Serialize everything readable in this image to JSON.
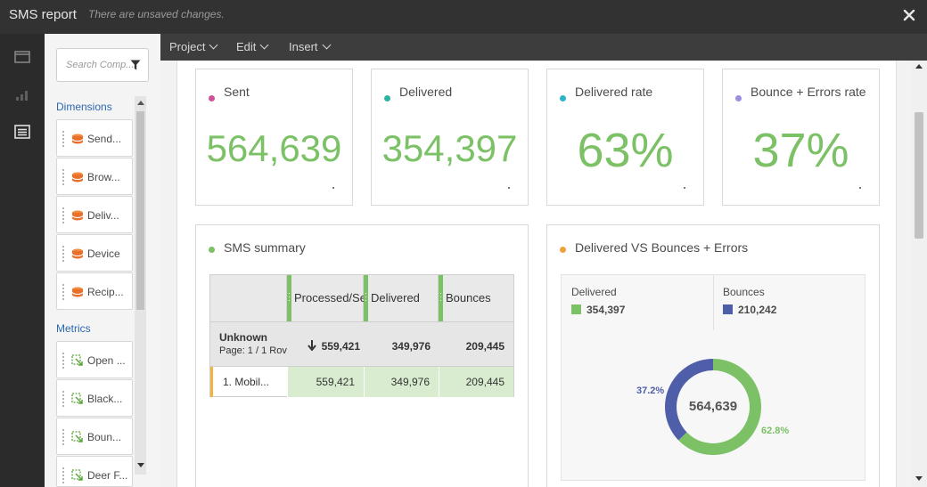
{
  "app": {
    "title": "SMS report",
    "status": "There are unsaved changes."
  },
  "rail": {
    "icons": [
      "panel-icon",
      "visualizations-icon",
      "components-icon"
    ]
  },
  "panel": {
    "search_placeholder": "Search Comp...",
    "dimensions_label": "Dimensions",
    "dimensions": [
      "Send...",
      "Brow...",
      "Deliv...",
      "Device",
      "Recip..."
    ],
    "metrics_label": "Metrics",
    "metrics": [
      "Open ...",
      "Black...",
      "Boun...",
      "Deer F..."
    ]
  },
  "menu": {
    "items": [
      "Project",
      "Edit",
      "Insert"
    ]
  },
  "kpis": [
    {
      "label": "Sent",
      "value": "564,639",
      "dot_color": "#d0519a"
    },
    {
      "label": "Delivered",
      "value": "354,397",
      "dot_color": "#2bb3a0"
    },
    {
      "label": "Delivered rate",
      "value": "63%",
      "dot_color": "#2bb3c8"
    },
    {
      "label": "Bounce + Errors rate",
      "value": "37%",
      "dot_color": "#9a8fe0"
    }
  ],
  "summary": {
    "title": "SMS summary",
    "dot_color": "#7cc166",
    "columns": [
      "Processed/Se",
      "Delivered",
      "Bounces"
    ],
    "total": {
      "name": "Unknown",
      "sub": "Page: 1 / 1  Rov",
      "values": [
        "559,421",
        "349,976",
        "209,445"
      ],
      "sort_icon": "sort-descending-icon"
    },
    "rows": [
      {
        "label": "1.    Mobil...",
        "values": [
          "559,421",
          "349,976",
          "209,445"
        ]
      }
    ]
  },
  "donut": {
    "title": "Delivered VS Bounces + Errors",
    "dot_color": "#f0a13a",
    "legend": [
      {
        "name": "Delivered",
        "value": "354,397",
        "color": "#7cc166"
      },
      {
        "name": "Bounces",
        "value": "210,242",
        "color": "#4f5ea8"
      }
    ],
    "center_label": "564,639",
    "pct_bounces": "37.2%",
    "pct_delivered": "62.8%"
  },
  "chart_data": {
    "type": "pie",
    "title": "Delivered VS Bounces + Errors",
    "categories": [
      "Delivered",
      "Bounces"
    ],
    "values": [
      354397,
      210242
    ],
    "percent_labels": [
      "62.8%",
      "37.2%"
    ],
    "total": 564639,
    "colors": [
      "#7cc166",
      "#4f5ea8"
    ]
  }
}
